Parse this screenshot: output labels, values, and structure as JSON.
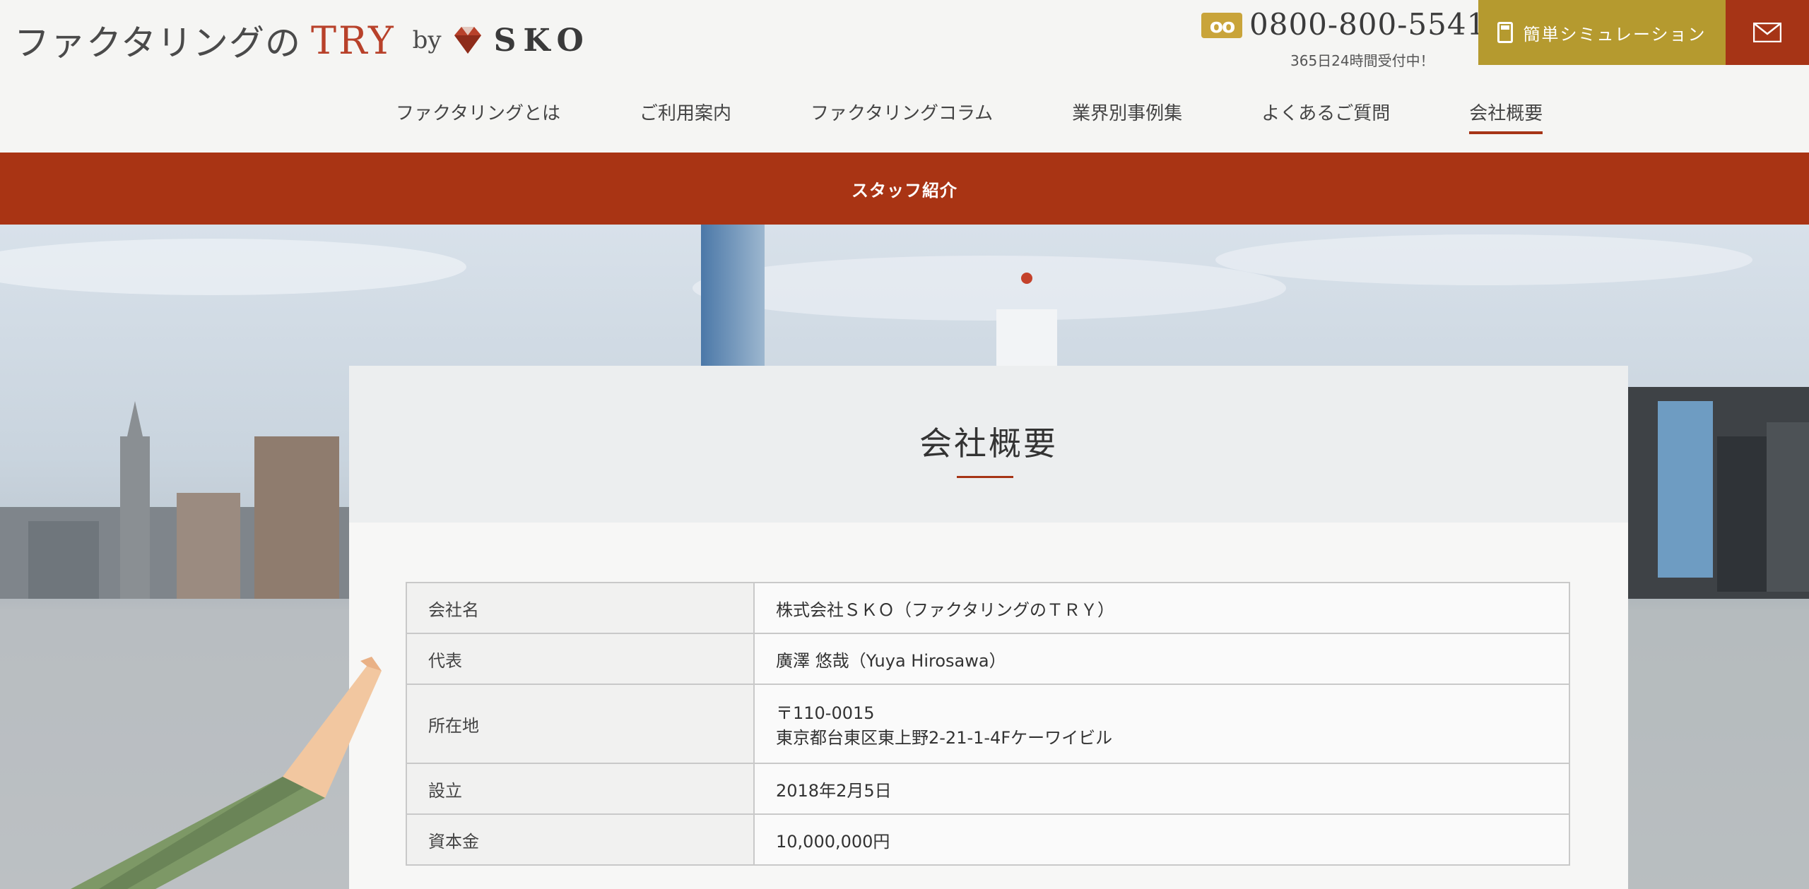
{
  "header": {
    "logo": {
      "main": "ファクタリングの",
      "try": "TRY",
      "by": "by",
      "company": "SKO"
    },
    "phone": {
      "icon": "free-dial-icon",
      "number": "0800-800-5541",
      "note": "365日24時間受付中！"
    },
    "simulation_label": "簡単シミュレーション",
    "mail_icon": "mail-icon"
  },
  "nav": {
    "items": [
      {
        "label": "ファクタリングとは"
      },
      {
        "label": "ご利用案内"
      },
      {
        "label": "ファクタリングコラム"
      },
      {
        "label": "業界別事例集"
      },
      {
        "label": "よくあるご質問"
      },
      {
        "label": "会社概要"
      }
    ],
    "active": "会社概要"
  },
  "subnav": {
    "items": [
      {
        "label": "スタッフ紹介"
      }
    ]
  },
  "page": {
    "title": "会社概要",
    "rows": [
      {
        "label": "会社名",
        "value": "株式会社ＳＫＯ（ファクタリングのＴＲＹ）"
      },
      {
        "label": "代表",
        "value": "廣澤 悠哉（Yuya Hirosawa）"
      },
      {
        "label": "所在地",
        "value": "〒110-0015",
        "value2": "東京都台東区東上野2-21-1-4Fケーワイビル"
      },
      {
        "label": "設立",
        "value": "2018年2月5日"
      },
      {
        "label": "資本金",
        "value": "10,000,000円"
      }
    ]
  },
  "colors": {
    "brand_red": "#a93414",
    "gold": "#b59a2f",
    "text": "#333333"
  }
}
